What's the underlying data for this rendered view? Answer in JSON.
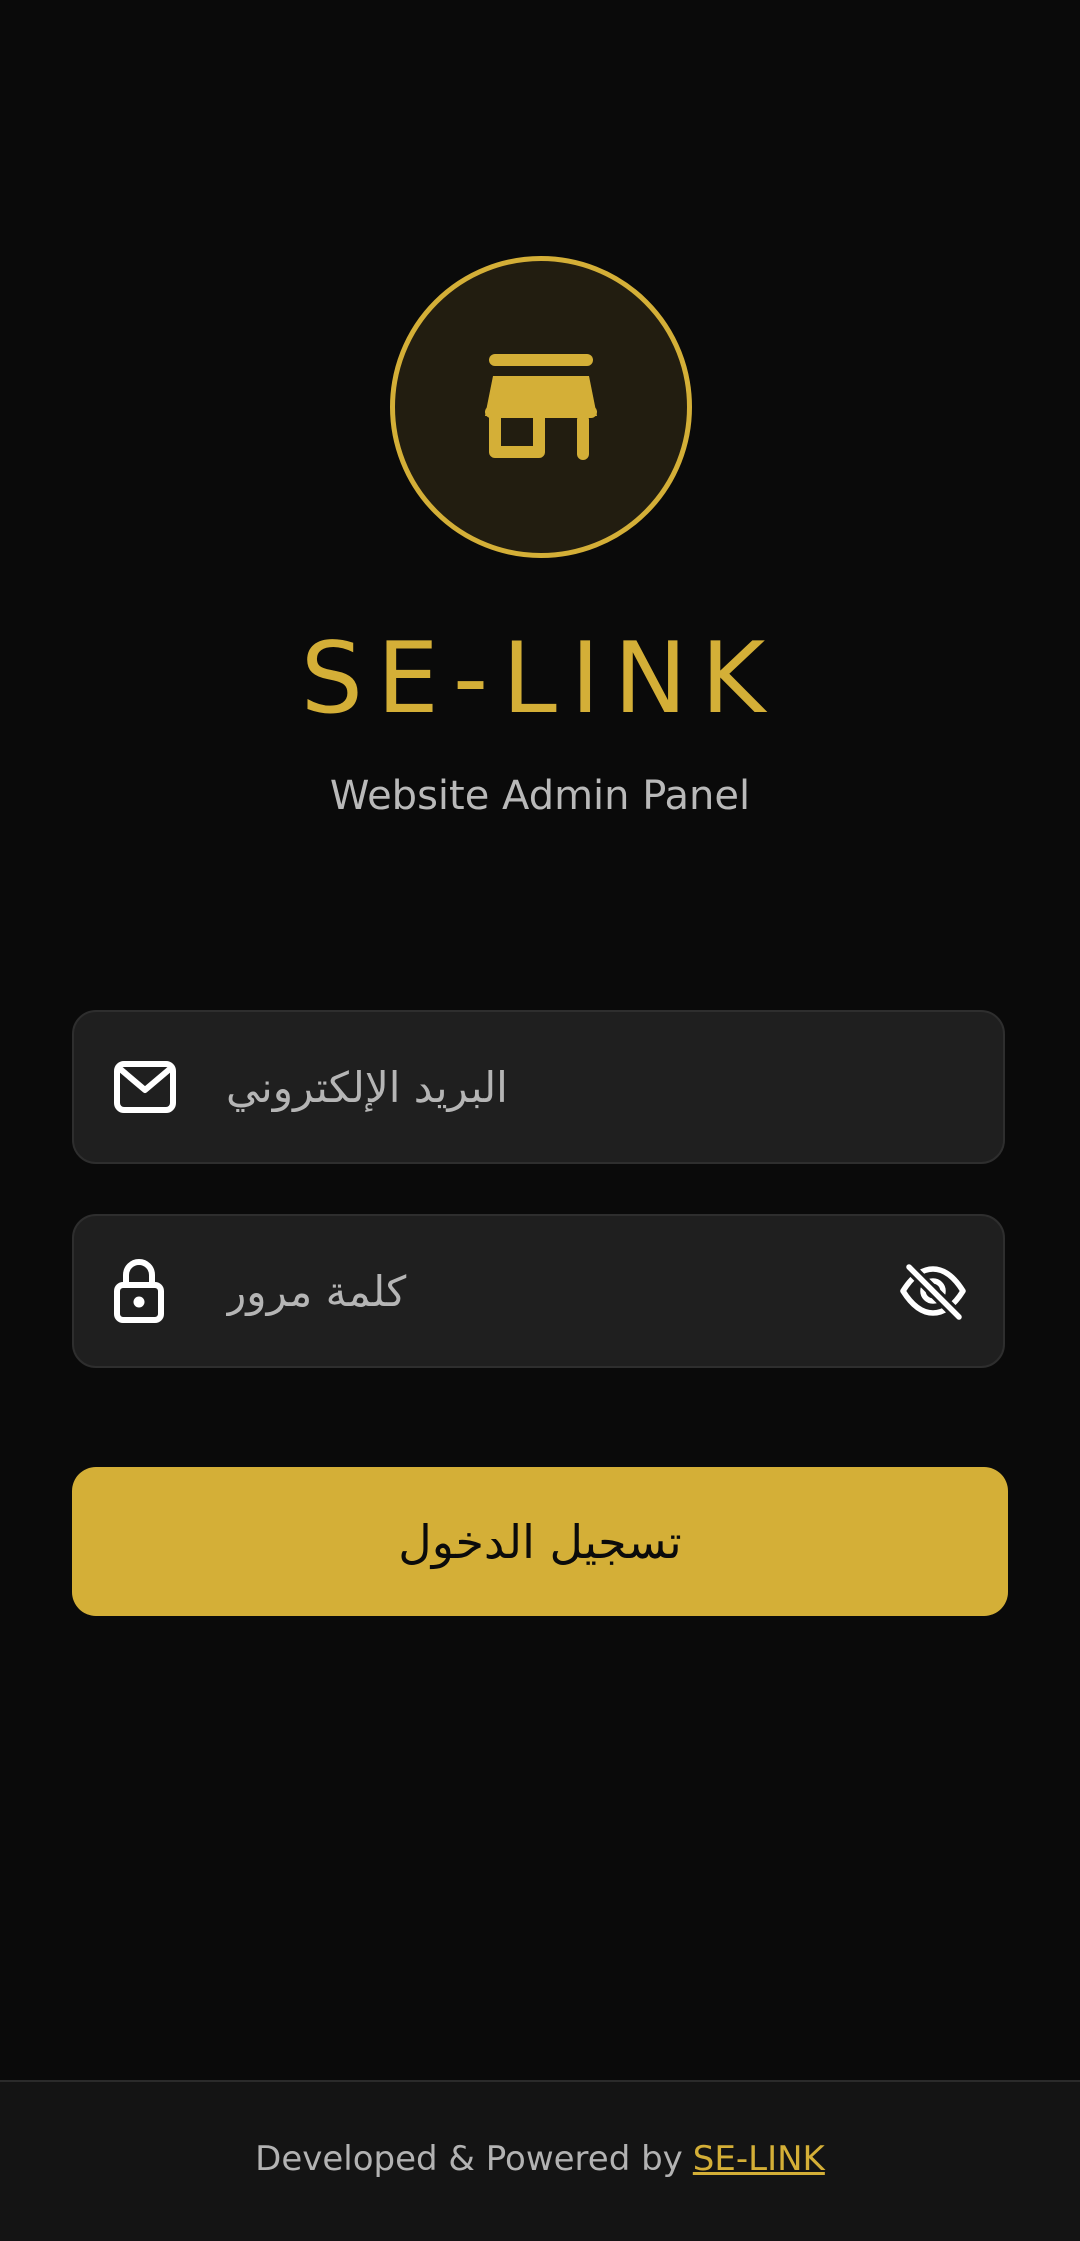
{
  "brand": {
    "title": "SE-LINK",
    "subtitle": "Website Admin Panel",
    "accent_color": "#d4af37",
    "logo_icon": "store-icon"
  },
  "form": {
    "email": {
      "placeholder": "البريد الإلكتروني",
      "value": "",
      "icon": "mail-icon"
    },
    "password": {
      "placeholder": "كلمة مرور",
      "value": "",
      "icon": "lock-icon",
      "toggle_icon": "eye-off-icon"
    },
    "submit_label": "تسجيل الدخول"
  },
  "footer": {
    "text": "Developed & Powered by",
    "link_text": "SE-LINK"
  }
}
